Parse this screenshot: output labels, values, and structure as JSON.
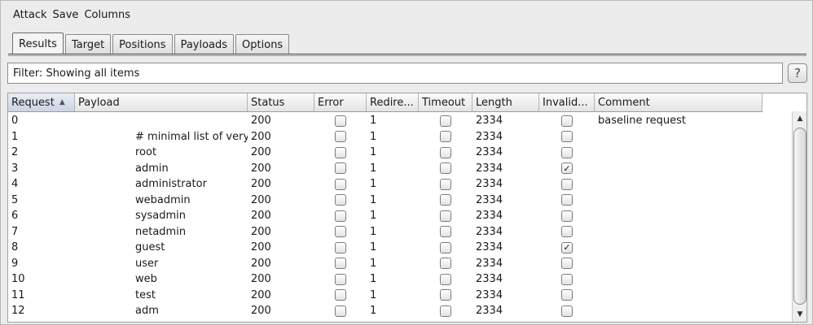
{
  "menu": [
    "Attack",
    "Save",
    "Columns"
  ],
  "tabs": [
    "Results",
    "Target",
    "Positions",
    "Payloads",
    "Options"
  ],
  "active_tab": 0,
  "filter": {
    "text": "Filter: Showing all items"
  },
  "help": {
    "label": "?"
  },
  "table": {
    "columns": [
      "Request",
      "Payload",
      "Status",
      "Error",
      "Redire...",
      "Timeout",
      "Length",
      "Invalid...",
      "Comment"
    ],
    "sorted_column": "Request",
    "sort_direction": "ascending",
    "rows": [
      {
        "request": "0",
        "payload": "",
        "status": "200",
        "error": false,
        "redirects": "1",
        "timeout": false,
        "length": "2334",
        "invalid": false,
        "comment": "baseline request"
      },
      {
        "request": "1",
        "payload": "# minimal list of very com...",
        "status": "200",
        "error": false,
        "redirects": "1",
        "timeout": false,
        "length": "2334",
        "invalid": false,
        "comment": ""
      },
      {
        "request": "2",
        "payload": "root",
        "status": "200",
        "error": false,
        "redirects": "1",
        "timeout": false,
        "length": "2334",
        "invalid": false,
        "comment": ""
      },
      {
        "request": "3",
        "payload": "admin",
        "status": "200",
        "error": false,
        "redirects": "1",
        "timeout": false,
        "length": "2334",
        "invalid": true,
        "comment": ""
      },
      {
        "request": "4",
        "payload": "administrator",
        "status": "200",
        "error": false,
        "redirects": "1",
        "timeout": false,
        "length": "2334",
        "invalid": false,
        "comment": ""
      },
      {
        "request": "5",
        "payload": "webadmin",
        "status": "200",
        "error": false,
        "redirects": "1",
        "timeout": false,
        "length": "2334",
        "invalid": false,
        "comment": ""
      },
      {
        "request": "6",
        "payload": "sysadmin",
        "status": "200",
        "error": false,
        "redirects": "1",
        "timeout": false,
        "length": "2334",
        "invalid": false,
        "comment": ""
      },
      {
        "request": "7",
        "payload": "netadmin",
        "status": "200",
        "error": false,
        "redirects": "1",
        "timeout": false,
        "length": "2334",
        "invalid": false,
        "comment": ""
      },
      {
        "request": "8",
        "payload": "guest",
        "status": "200",
        "error": false,
        "redirects": "1",
        "timeout": false,
        "length": "2334",
        "invalid": true,
        "comment": ""
      },
      {
        "request": "9",
        "payload": "user",
        "status": "200",
        "error": false,
        "redirects": "1",
        "timeout": false,
        "length": "2334",
        "invalid": false,
        "comment": ""
      },
      {
        "request": "10",
        "payload": "web",
        "status": "200",
        "error": false,
        "redirects": "1",
        "timeout": false,
        "length": "2334",
        "invalid": false,
        "comment": ""
      },
      {
        "request": "11",
        "payload": "test",
        "status": "200",
        "error": false,
        "redirects": "1",
        "timeout": false,
        "length": "2334",
        "invalid": false,
        "comment": ""
      },
      {
        "request": "12",
        "payload": "adm",
        "status": "200",
        "error": false,
        "redirects": "1",
        "timeout": false,
        "length": "2334",
        "invalid": false,
        "comment": ""
      }
    ]
  },
  "icons": {
    "sort": "triangle-up-icon",
    "checkbox_checked": "check-icon",
    "scroll_up": "arrow-up-icon",
    "scroll_down": "arrow-down-icon"
  },
  "colors": {
    "window_bg": "#ececec",
    "table_bg": "#ffffff",
    "sorted_header": "#c9d4e4"
  }
}
